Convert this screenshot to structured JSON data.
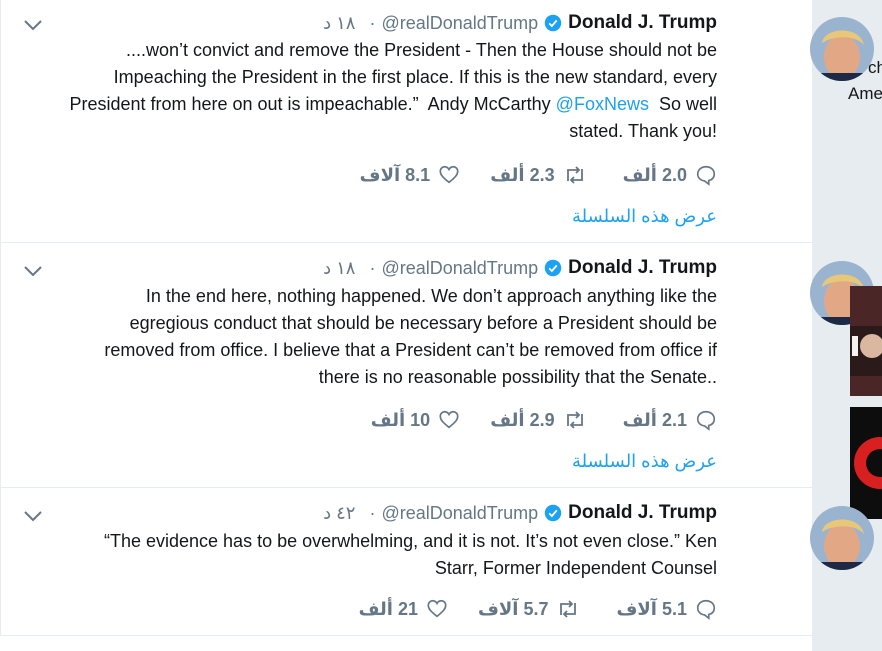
{
  "account": {
    "name": "Donald J. Trump",
    "handle": "@realDonaldTrump"
  },
  "tweets": [
    {
      "time": "١٨ د",
      "text_lines": [
        "....won’t convict and remove the President - Then the House should not be",
        "Impeaching the President in the first place. If this is the new standard, every",
        "President from here on out is impeachable.”  Andy McCarthy "
      ],
      "mention": "@FoxNews",
      "text_after_mention": "  So well",
      "last_line": "stated. Thank you!",
      "replies": "2.0 ألف",
      "retweets": "2.3 ألف",
      "likes": "8.1 آلاف",
      "thread_link": "عرض هذه السلسلة"
    },
    {
      "time": "١٨ د",
      "text_lines": [
        "In the end here, nothing happened. We don’t approach anything like the",
        "egregious conduct that should be necessary before a President should be",
        "removed from office. I believe that a President can’t be removed from office if",
        "there is no reasonable possibility that the Senate.."
      ],
      "replies": "2.1 ألف",
      "retweets": "2.9 ألف",
      "likes": "10 ألف",
      "thread_link": "عرض هذه السلسلة"
    },
    {
      "time": "٤٢ د",
      "text_lines": [
        "“The evidence has to be overwhelming, and it is not. It’s not even close.” Ken",
        "Starr, Former Independent Counsel"
      ],
      "replies": "5.1 آلاف",
      "retweets": "5.7 آلاف",
      "likes": "21 ألف"
    }
  ],
  "sidebar": {
    "text1": "ch",
    "text2": "Ame"
  },
  "colors": {
    "link": "#1da1f2",
    "muted": "#657786",
    "text": "#14171a",
    "background": "#e6ecf0"
  },
  "icons": [
    "chevron-down-icon",
    "verified-badge-icon",
    "reply-icon",
    "retweet-icon",
    "like-icon"
  ]
}
